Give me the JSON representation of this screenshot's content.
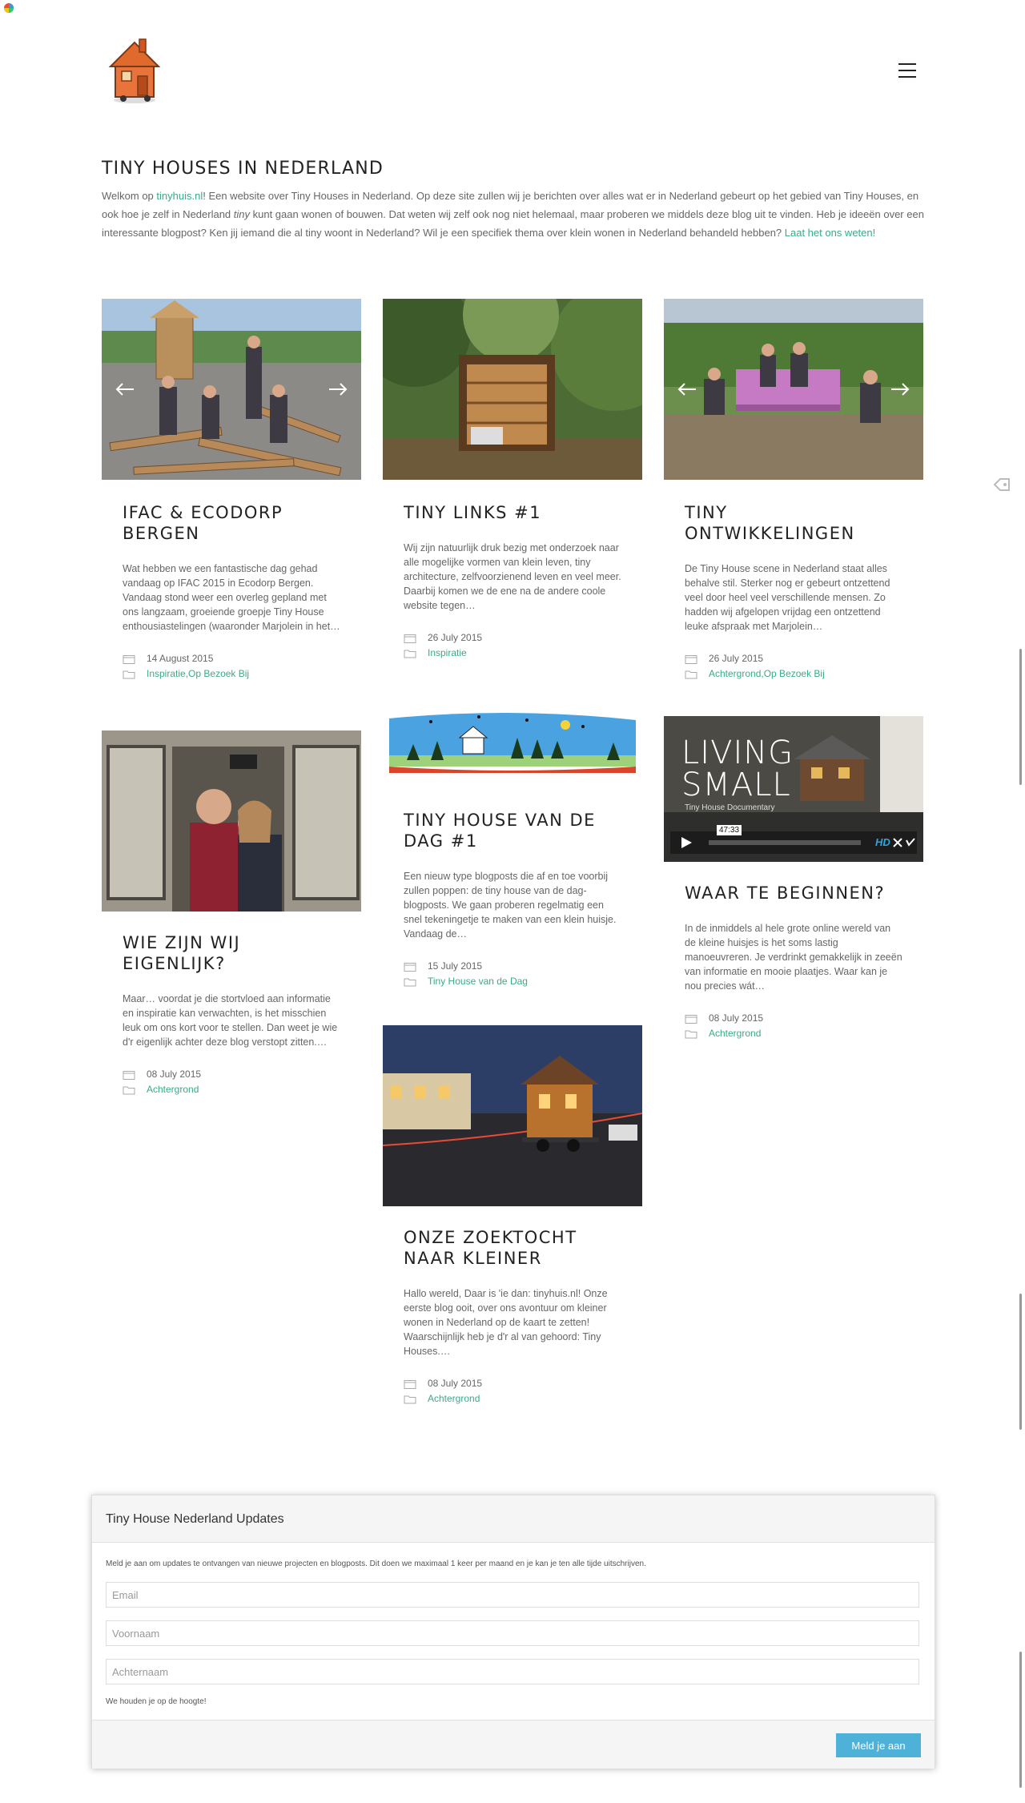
{
  "site": {
    "title": "TINY HOUSES IN NEDERLAND",
    "intro": {
      "p1_before": "Welkom op ",
      "site_link": "tinyhuis.nl",
      "p1_after": "! Een website over Tiny Houses in Nederland. Op deze site zullen wij je berichten over alles wat er in Nederland gebeurt op het gebied van Tiny Houses, en ook hoe je zelf in Nederland ",
      "italic": "tiny",
      "p1_rest": " kunt gaan wonen of bouwen. Dat weten wij zelf ook nog niet helemaal, maar proberen we middels deze blog uit te vinden. Heb je ideeën over een interessante blogpost? Ken jij iemand die al tiny woont in Nederland? Wil je een specifiek thema over klein wonen in Nederland behandeld hebben? ",
      "contact_link": "Laat het ons weten!"
    }
  },
  "icons": {
    "logo": "tiny-house-logo",
    "menu": "hamburger-menu-icon",
    "date": "calendar-icon",
    "category": "folder-icon",
    "nav_prev": "arrow-left-icon",
    "nav_next": "arrow-right-icon"
  },
  "colors": {
    "link": "#3aaa8a",
    "button": "#4eb2d8",
    "title": "#222222"
  },
  "posts": [
    {
      "title": "IFAC & ECODORP BERGEN",
      "excerpt": "Wat hebben we een fantastische dag gehad vandaag op IFAC 2015 in Ecodorp Bergen. Vandaag stond weer een overleg gepland met ons langzaam, groeiende groepje Tiny House enthousiastelingen (waaronder Marjolein in het…",
      "date": "14 August 2015",
      "cat1": "Inspiratie",
      "sep": ", ",
      "cat2": "Op Bezoek Bij"
    },
    {
      "title": "TINY LINKS #1",
      "excerpt": "Wij zijn natuurlijk druk bezig met onderzoek naar alle mogelijke vormen van klein leven, tiny architecture, zelfvoorzienend leven en veel meer. Daarbij komen we de ene na de andere coole website tegen…",
      "date": "26 July 2015",
      "cat1": "Inspiratie"
    },
    {
      "title": "TINY ONTWIKKELINGEN",
      "excerpt": "De Tiny House scene in Nederland staat alles behalve stil. Sterker nog er gebeurt ontzettend veel door heel veel verschillende mensen. Zo hadden wij afgelopen vrijdag een ontzettend leuke afspraak met Marjolein…",
      "date": "26 July 2015",
      "cat1": "Achtergrond",
      "sep": ", ",
      "cat2": "Op Bezoek Bij"
    },
    {
      "title": "WIE ZIJN WIJ EIGENLIJK?",
      "excerpt": "Maar… voordat je die stortvloed aan informatie en inspiratie kan verwachten, is het misschien leuk om ons kort voor te stellen. Dan weet je wie d'r eigenlijk achter deze blog verstopt zitten.…",
      "date": "08 July 2015",
      "cat1": "Achtergrond"
    },
    {
      "title": "TINY HOUSE VAN DE DAG #1",
      "excerpt": "Een nieuw type blogposts die af en toe voorbij zullen poppen: de tiny house van de dag-blogposts. We gaan proberen regelmatig een snel tekeningetje te maken van een klein huisje. Vandaag de…",
      "date": "15 July 2015",
      "cat1": "Tiny House van de Dag"
    },
    {
      "title": "WAAR TE BEGINNEN?",
      "excerpt": "In de inmiddels al hele grote online wereld van de kleine huisjes is het soms lastig manoeuvreren. Je verdrinkt gemakkelijk in zeeën van informatie en mooie plaatjes. Waar kan je nou precies wát…",
      "date": "08 July 2015",
      "cat1": "Achtergrond"
    },
    {
      "title": "ONZE ZOEKTOCHT NAAR KLEINER",
      "excerpt": "Hallo wereld, Daar is 'ie dan: tinyhuis.nl! Onze eerste blog ooit, over ons avontuur om kleiner wonen in Nederland op de kaart te zetten! Waarschijnlijk heb je d'r al van gehoord: Tiny Houses.…",
      "date": "08 July 2015",
      "cat1": "Achtergrond"
    }
  ],
  "video": {
    "title_line1": "LIVING",
    "title_line2": "SMALL",
    "subtitle": "Tiny House Documentary",
    "duration": "47:33",
    "hd": "HD",
    "icons": [
      "play-icon",
      "fullscreen-icon",
      "vimeo-icon"
    ]
  },
  "signup": {
    "title": "Tiny House Nederland Updates",
    "description": "Meld je aan om updates te ontvangen van nieuwe projecten en blogposts. Dit doen we maximaal 1 keer per maand en je kan je ten alle tijde uitschrijven.",
    "email_placeholder": "Email",
    "firstname_placeholder": "Voornaam",
    "lastname_placeholder": "Achternaam",
    "note": "We houden je op de hoogte!",
    "button": "Meld je aan"
  }
}
